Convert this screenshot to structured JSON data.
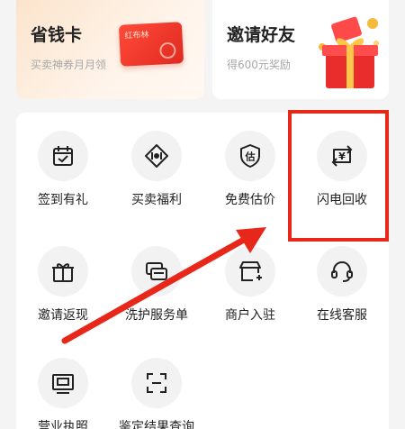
{
  "promos": {
    "savings_card": {
      "title": "省钱卡",
      "subtitle": "买卖神券月月领",
      "card_text": "红布林"
    },
    "invite": {
      "title": "邀请好友",
      "subtitle": "得600元奖励"
    }
  },
  "grid": {
    "items": [
      {
        "label": "签到有礼",
        "icon": "calendar-check-icon"
      },
      {
        "label": "买卖福利",
        "icon": "tag-icon"
      },
      {
        "label": "免费估价",
        "icon": "shield-estimate-icon"
      },
      {
        "label": "闪电回收",
        "icon": "yuan-exchange-icon"
      },
      {
        "label": "邀请返现",
        "icon": "gift-box-icon"
      },
      {
        "label": "洗护服务单",
        "icon": "cards-icon"
      },
      {
        "label": "商户入驻",
        "icon": "store-add-icon"
      },
      {
        "label": "在线客服",
        "icon": "headset-icon"
      },
      {
        "label": "营业执照",
        "icon": "license-icon"
      },
      {
        "label": "鉴定结果查询",
        "icon": "scan-icon"
      }
    ],
    "estimate_glyph": "估",
    "yuan_glyph": "¥"
  },
  "annotation": {
    "highlight_color": "#e8271b"
  }
}
